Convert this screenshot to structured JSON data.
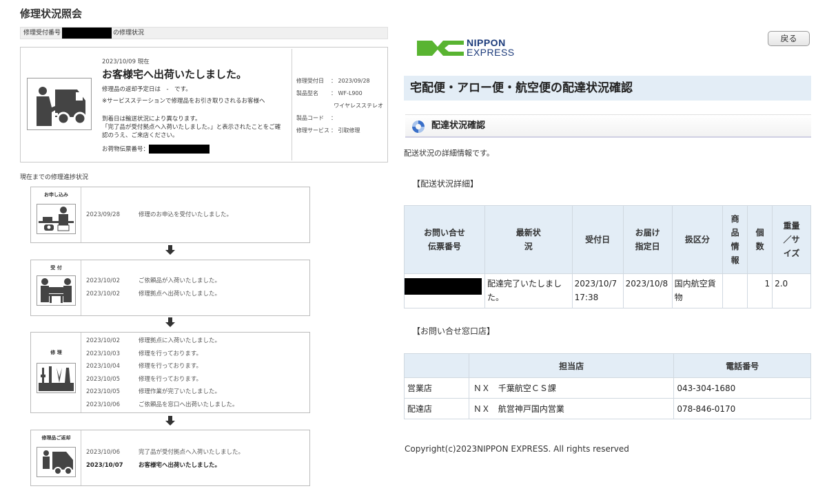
{
  "left": {
    "title": "修理状況照会",
    "repair_no_prefix": "修理受付番号",
    "repair_no_suffix": "の修理状況",
    "status": {
      "date": "2023/10/09 現在",
      "headline": "お客様宅へ出荷いたしました。",
      "return_schedule": "修理品の返却予定日は　-　です。",
      "note1": "※サービスステーションで修理品をお引き取りされるお客様へ",
      "note2": "到着日は輸送状況により異なります。",
      "note3": "「完了品が受付拠点へ入荷いたしました。」と表示されたことをご確認のうえ、ご来店ください。",
      "tracking_label": "お荷物伝票番号："
    },
    "info": [
      {
        "key": "修理受付日",
        "value": "： 2023/09/28"
      },
      {
        "key": "製品型名",
        "value": "： WF-L900"
      },
      {
        "key": "",
        "value": "ワイヤレスステレオ"
      },
      {
        "key": "製品コード",
        "value": "："
      },
      {
        "key": "修理サービス",
        "value": "： 引取修理"
      }
    ],
    "progress_label": "現在までの修理進捗状況",
    "steps": [
      {
        "label": "お申し込み",
        "lines": [
          {
            "date": "2023/09/28",
            "text": "修理のお申込を受付いたしました。"
          }
        ]
      },
      {
        "label": "受 付",
        "lines": [
          {
            "date": "2023/10/02",
            "text": "ご依頼品が入荷いたしました。"
          },
          {
            "date": "2023/10/02",
            "text": "修理拠点へ出荷いたしました。"
          }
        ]
      },
      {
        "label": "修 理",
        "lines": [
          {
            "date": "2023/10/02",
            "text": "修理拠点に入荷いたしました。"
          },
          {
            "date": "2023/10/03",
            "text": "修理を行っております。"
          },
          {
            "date": "2023/10/04",
            "text": "修理を行っております。"
          },
          {
            "date": "2023/10/05",
            "text": "修理を行っております。"
          },
          {
            "date": "2023/10/05",
            "text": "修理作業が完了いたしました。"
          },
          {
            "date": "2023/10/06",
            "text": "ご依頼品を窓口へ出荷いたしました。"
          }
        ]
      },
      {
        "label": "修理品ご返却",
        "lines": [
          {
            "date": "2023/10/06",
            "text": "完了品が受付拠点へ入荷いたしました。"
          },
          {
            "date": "2023/10/07",
            "text": "お客様宅へ出荷いたしました。"
          }
        ]
      }
    ]
  },
  "right": {
    "logo_line1": "NIPPON",
    "logo_line2": "EXPRESS",
    "logo_mark": "NEX",
    "back_label": "戻る",
    "page_title": "宅配便・アロー便・航空便の配達状況確認",
    "section_title": "配達状況確認",
    "description": "配送状況の詳細情報です。",
    "detail_heading": "【配送状況詳細】",
    "detail_table": {
      "headers": [
        "お問い合せ伝票番号",
        "最新状況",
        "受付日",
        "お届け指定日",
        "扱区分",
        "商品情報",
        "個数",
        "重量／サイズ"
      ],
      "row": {
        "status": "配達完了いたしました。",
        "accepted": "2023/10/7 17:38",
        "delivery_date": "2023/10/8",
        "category": "国内航空貨物",
        "item_info": "",
        "count": "1",
        "weight": "2.0"
      }
    },
    "contact_heading": "【お問い合せ窓口店】",
    "contact_table": {
      "headers": [
        "",
        "担当店",
        "電話番号"
      ],
      "rows": [
        {
          "type": "営業店",
          "store": "ＮＸ　千葉航空ＣＳ課",
          "phone": "043-304-1680"
        },
        {
          "type": "配達店",
          "store": "ＮＸ　航営神戸国内営業",
          "phone": "078-846-0170"
        }
      ]
    },
    "copyright": "Copyright(c)2023NIPPON EXPRESS. All rights reserved"
  },
  "icons": [
    "truck-icon",
    "reception-icon",
    "handover-icon",
    "tools-icon",
    "return-truck-icon",
    "down-arrow-icon",
    "spinner-icon"
  ],
  "colors": {
    "header_bg": "#e3edf6",
    "logo_green": "#59b431",
    "logo_blue": "#1b3a7a"
  }
}
